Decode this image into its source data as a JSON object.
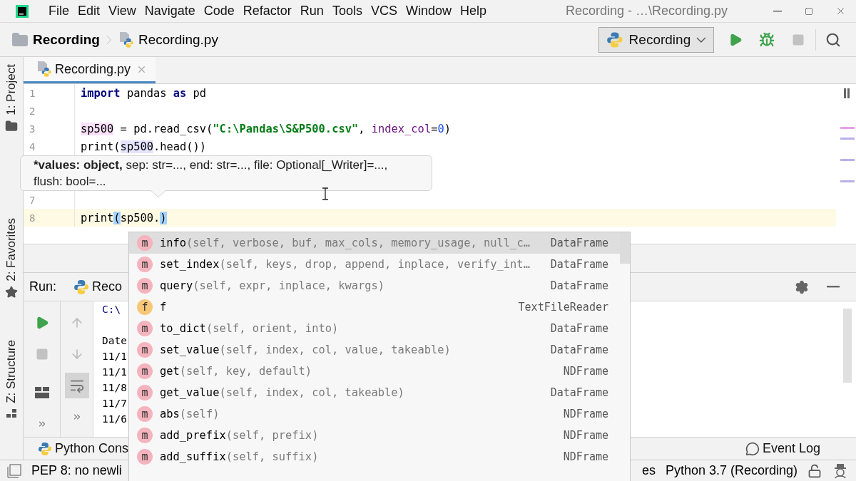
{
  "title_bar": {
    "menu": [
      "File",
      "Edit",
      "View",
      "Navigate",
      "Code",
      "Refactor",
      "Run",
      "Tools",
      "VCS",
      "Window",
      "Help"
    ],
    "title": "Recording - …\\Recording.py"
  },
  "nav_bar": {
    "breadcrumbs": [
      {
        "kind": "folder",
        "label": "Recording"
      },
      {
        "kind": "file",
        "label": "Recording.py"
      }
    ],
    "run_config": "Recording"
  },
  "side_strip": [
    {
      "kind": "project",
      "label": "1: Project"
    },
    {
      "kind": "favorites",
      "label": "2: Favorites"
    },
    {
      "kind": "structure",
      "label": "Z: Structure"
    }
  ],
  "editor": {
    "tabs": [
      {
        "label": "Recording.py",
        "selected": true
      }
    ],
    "lines": [
      {
        "kind": "code",
        "number": "1",
        "current": false,
        "tokens": [
          {
            "kind": "keyword",
            "text": "import"
          },
          {
            "kind": "plain",
            "text": " pandas "
          },
          {
            "kind": "keyword",
            "text": "as"
          },
          {
            "kind": "plain",
            "text": " pd"
          }
        ]
      },
      {
        "kind": "code",
        "number": "2",
        "current": false
      },
      {
        "kind": "code",
        "number": "3",
        "current": false,
        "tokens": [
          {
            "kind": "write",
            "text": "sp500"
          },
          {
            "kind": "plain",
            "text": " = pd.read_csv("
          },
          {
            "kind": "string",
            "text": "\"C:\\Pandas\\S&P500.csv\""
          },
          {
            "kind": "plain",
            "text": ", "
          },
          {
            "kind": "param",
            "text": "index_col"
          },
          {
            "kind": "plain",
            "text": "="
          },
          {
            "kind": "number",
            "text": "0"
          },
          {
            "kind": "plain",
            "text": ")"
          }
        ]
      },
      {
        "kind": "code",
        "number": "4",
        "current": false,
        "tokens": [
          {
            "kind": "plain",
            "text": "print("
          },
          {
            "kind": "read",
            "text": "sp500"
          },
          {
            "kind": "plain",
            "text": ".head())"
          }
        ]
      },
      {
        "kind": "hint",
        "current_param": "*values: object,",
        "rest": " sep: str=..., end: str=..., file: Optional[_Writer]=..., flush: bool=..."
      },
      {
        "kind": "code",
        "number": "7",
        "current": false
      },
      {
        "kind": "code",
        "number": "8",
        "current": true,
        "tokens": [
          {
            "kind": "plain",
            "text": "print"
          },
          {
            "kind": "brace",
            "text": "("
          },
          {
            "kind": "plain",
            "text": "sp500."
          },
          {
            "kind": "brace",
            "text": ")"
          }
        ]
      }
    ]
  },
  "completion": [
    {
      "kind": "method",
      "badge": "m",
      "name": "info",
      "params": "(self, verbose, buf, max_cols, memory_usage, null_c…",
      "type": "DataFrame",
      "selected": true
    },
    {
      "kind": "method",
      "badge": "m",
      "name": "set_index",
      "params": "(self, keys, drop, append, inplace, verify_int…",
      "type": "DataFrame",
      "selected": false
    },
    {
      "kind": "method",
      "badge": "m",
      "name": "query",
      "params": "(self, expr, inplace, kwargs)",
      "type": "DataFrame",
      "selected": false
    },
    {
      "kind": "field",
      "badge": "f",
      "name": "f",
      "type": "TextFileReader",
      "selected": false
    },
    {
      "kind": "method",
      "badge": "m",
      "name": "to_dict",
      "params": "(self, orient, into)",
      "type": "DataFrame",
      "selected": false
    },
    {
      "kind": "method",
      "badge": "m",
      "name": "set_value",
      "params": "(self, index, col, value, takeable)",
      "type": "DataFrame",
      "selected": false
    },
    {
      "kind": "method",
      "badge": "m",
      "name": "get",
      "params": "(self, key, default)",
      "type": "NDFrame",
      "selected": false
    },
    {
      "kind": "method",
      "badge": "m",
      "name": "get_value",
      "params": "(self, index, col, takeable)",
      "type": "DataFrame",
      "selected": false
    },
    {
      "kind": "method",
      "badge": "m",
      "name": "abs",
      "params": "(self)",
      "type": "NDFrame",
      "selected": false
    },
    {
      "kind": "method",
      "badge": "m",
      "name": "add_prefix",
      "params": "(self, prefix)",
      "type": "NDFrame",
      "selected": false
    },
    {
      "kind": "method",
      "badge": "m",
      "name": "add_suffix",
      "params": "(self, suffix)",
      "type": "NDFrame",
      "selected": false
    }
  ],
  "run_panel": {
    "label": "Run:",
    "tab": "Reco",
    "wrap_on": true,
    "output": [
      {
        "kind": "path",
        "text": "C:\\"
      },
      {
        "kind": "blank"
      },
      {
        "kind": "text",
        "text": "Date"
      },
      {
        "kind": "text",
        "text": "11/1"
      },
      {
        "kind": "text",
        "text": "11/1"
      },
      {
        "kind": "text",
        "text": "11/8"
      },
      {
        "kind": "text",
        "text": "11/7"
      },
      {
        "kind": "text",
        "text": "11/6"
      }
    ]
  },
  "bottom_bar": {
    "left": "Python Cons",
    "right": "Event Log"
  },
  "status_bar": {
    "message": "PEP 8: no newli",
    "partial": "es",
    "interpreter": "Python 3.7 (Recording)"
  }
}
